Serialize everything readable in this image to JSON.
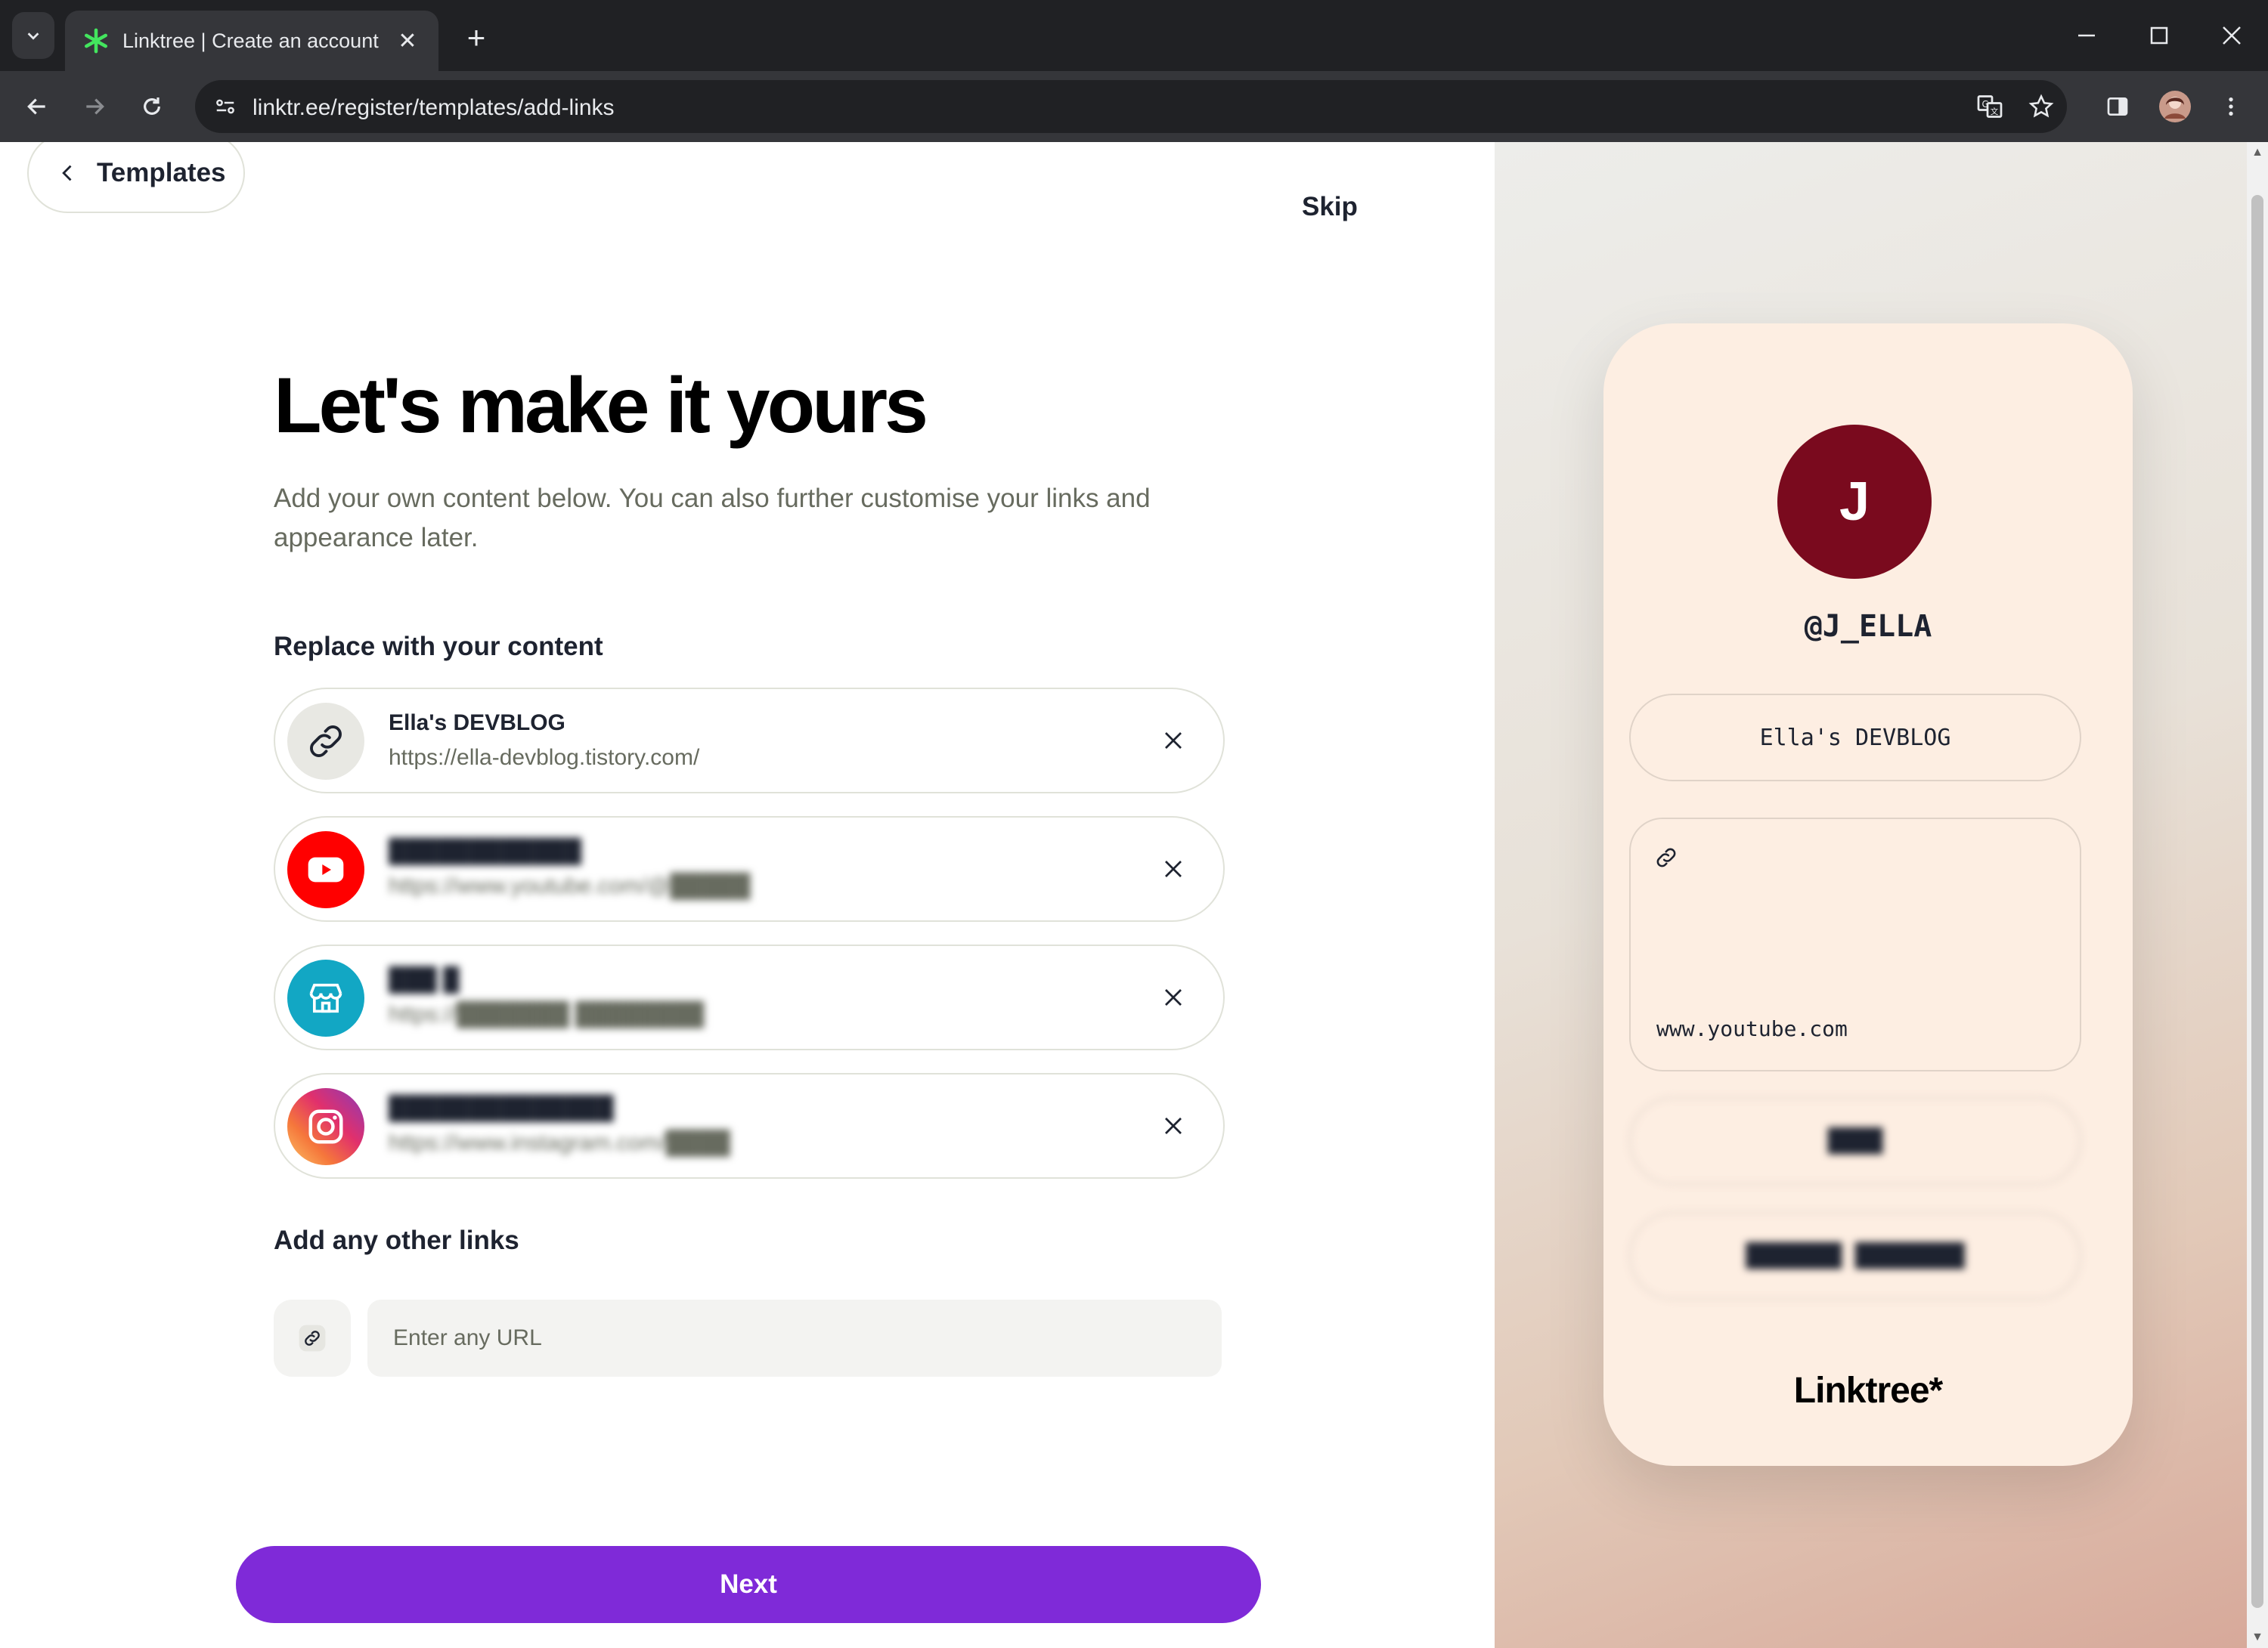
{
  "browser": {
    "tab_title": "Linktree | Create an account for",
    "url": "linktr.ee/register/templates/add-links"
  },
  "header": {
    "back_label": "Templates",
    "skip_label": "Skip"
  },
  "main": {
    "title": "Let's make it yours",
    "subtitle": "Add your own content below. You can also further customise your links and appearance later.",
    "replace_label": "Replace with your content",
    "other_links_label": "Add any other links",
    "url_placeholder": "Enter any URL",
    "next_label": "Next",
    "links": [
      {
        "title": "Ella's DEVBLOG",
        "url": "https://ella-devblog.tistory.com/",
        "icon": "link-icon",
        "color": "#e8e8e3"
      },
      {
        "title": "████████████",
        "url": "https://www.youtube.com/@█████",
        "icon": "youtube-icon",
        "color": "#ff0000",
        "redacted": true
      },
      {
        "title": "███ █",
        "url": "https://███████ ████████",
        "icon": "store-icon",
        "color": "#12a7c4",
        "redacted": true
      },
      {
        "title": "██████████████",
        "url": "https://www.instagram.com/████",
        "icon": "instagram-icon",
        "color": "#e1306c",
        "redacted": true
      }
    ]
  },
  "preview": {
    "avatar_letter": "J",
    "handle": "@J_ELLA",
    "blog_button": "Ella's DEVBLOG",
    "card_url": "www.youtube.com",
    "button_3": "████",
    "button_4": "███████ ████████",
    "brand": "Linktree*",
    "avatar_color": "#7a0a1e",
    "background": "#fdeee2"
  },
  "colors": {
    "accent": "#7f2ad8",
    "text": "#1e2330"
  }
}
